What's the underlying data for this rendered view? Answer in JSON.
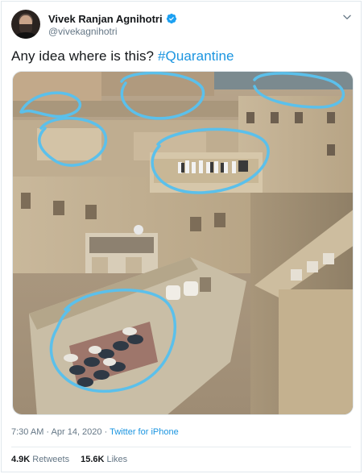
{
  "tweet": {
    "author_name": "Vivek Ranjan Agnihotri",
    "handle": "@vivekagnihotri",
    "text_prefix": "Any idea where is this? ",
    "hashtag": "#Quarantine",
    "time": "7:30 AM",
    "separator": " · ",
    "date": "Apr 14, 2020",
    "source": "Twitter for iPhone",
    "retweets_count": "4.9K",
    "retweets_label": "Retweets",
    "likes_count": "15.6K",
    "likes_label": "Likes"
  },
  "icons": {
    "verified": "verified-badge-icon",
    "menu": "chevron-down-icon"
  },
  "colors": {
    "link_blue": "#1b95e0",
    "annotation_blue": "#5bc0eb",
    "muted_text": "#657786"
  }
}
